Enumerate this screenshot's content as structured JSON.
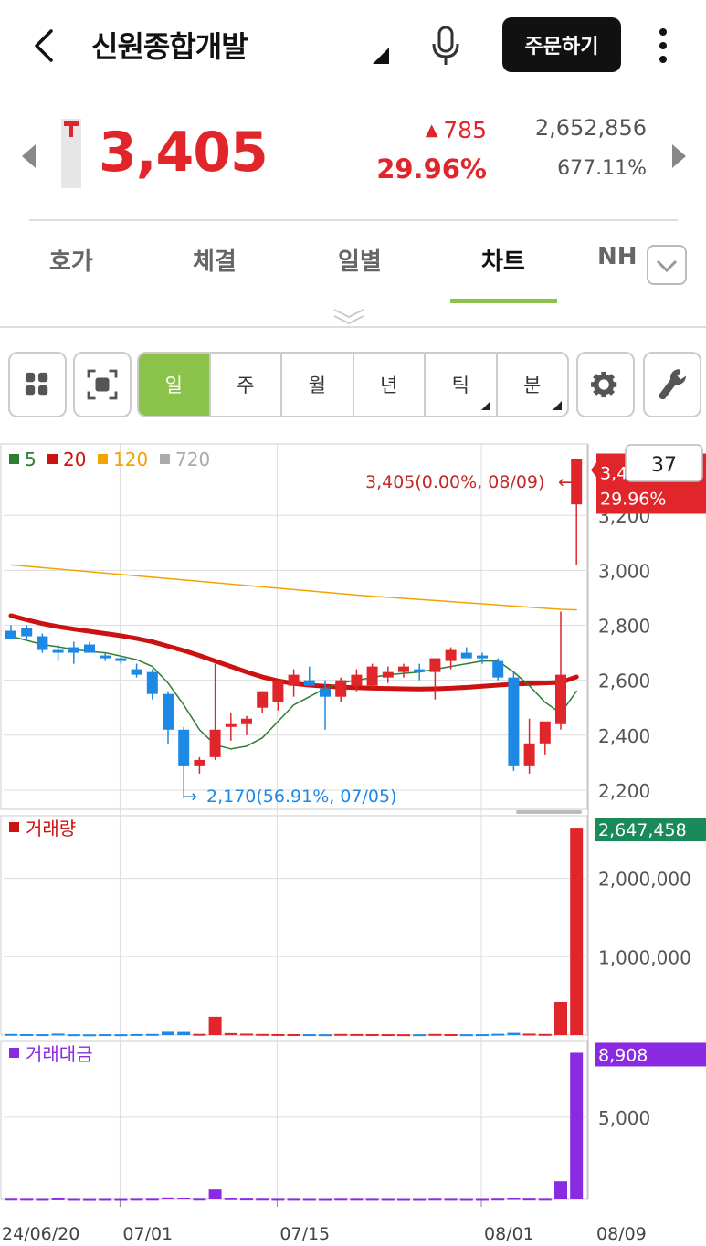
{
  "header": {
    "title": "신원종합개발",
    "order_label": "주문하기"
  },
  "quote": {
    "price": "3,405",
    "change": "785",
    "change_pct": "29.96%",
    "volume": "2,652,856",
    "volume_ratio": "677.11%"
  },
  "tabs": [
    {
      "label": "호가"
    },
    {
      "label": "체결"
    },
    {
      "label": "일별"
    },
    {
      "label": "차트"
    },
    {
      "label": "NH"
    }
  ],
  "period_buttons": [
    {
      "label": "일",
      "active": true
    },
    {
      "label": "주",
      "active": false
    },
    {
      "label": "월",
      "active": false
    },
    {
      "label": "년",
      "active": false
    },
    {
      "label": "틱",
      "active": false
    },
    {
      "label": "분",
      "active": false
    }
  ],
  "colors": {
    "up": "#e0262b",
    "down": "#1e88e5",
    "accent": "#8bc34a",
    "ma5": "#2e7d32",
    "ma20": "#cc1111",
    "ma120": "#f4a300",
    "ma720": "#aaaaaa",
    "value_bar": "#8a2be2",
    "vol_tag": "#1b8a5a"
  },
  "chart_data": [
    {
      "type": "candlestick",
      "legend": [
        {
          "name": "5",
          "color": "#2e7d32"
        },
        {
          "name": "20",
          "color": "#cc1111"
        },
        {
          "name": "120",
          "color": "#f4a300"
        },
        {
          "name": "720",
          "color": "#aaaaaa"
        }
      ],
      "y_ticks": [
        "3,200",
        "3,000",
        "2,800",
        "2,600",
        "2,400",
        "2,200"
      ],
      "ylim": [
        2130,
        3460
      ],
      "x_ticks": [
        "24/06/20",
        "07/01",
        "07/15",
        "08/01",
        "08/09"
      ],
      "candle_count_box": "37",
      "price_tag": {
        "value": "3,405",
        "pct": "29.96%"
      },
      "high_annotation": "3,405(0.00%, 08/09)",
      "low_annotation": "2,170(56.91%, 07/05)",
      "candles": [
        {
          "o": 2780,
          "h": 2800,
          "l": 2760,
          "c": 2750
        },
        {
          "o": 2790,
          "h": 2800,
          "l": 2750,
          "c": 2760
        },
        {
          "o": 2760,
          "h": 2770,
          "l": 2700,
          "c": 2710
        },
        {
          "o": 2710,
          "h": 2730,
          "l": 2670,
          "c": 2700
        },
        {
          "o": 2720,
          "h": 2740,
          "l": 2660,
          "c": 2700
        },
        {
          "o": 2730,
          "h": 2740,
          "l": 2700,
          "c": 2700
        },
        {
          "o": 2690,
          "h": 2700,
          "l": 2670,
          "c": 2680
        },
        {
          "o": 2680,
          "h": 2690,
          "l": 2660,
          "c": 2670
        },
        {
          "o": 2640,
          "h": 2660,
          "l": 2610,
          "c": 2620
        },
        {
          "o": 2630,
          "h": 2640,
          "l": 2530,
          "c": 2550
        },
        {
          "o": 2550,
          "h": 2560,
          "l": 2370,
          "c": 2420
        },
        {
          "o": 2420,
          "h": 2430,
          "l": 2170,
          "c": 2290
        },
        {
          "o": 2290,
          "h": 2320,
          "l": 2260,
          "c": 2310
        },
        {
          "o": 2320,
          "h": 2660,
          "l": 2310,
          "c": 2420
        },
        {
          "o": 2430,
          "h": 2480,
          "l": 2380,
          "c": 2440
        },
        {
          "o": 2440,
          "h": 2470,
          "l": 2400,
          "c": 2460
        },
        {
          "o": 2500,
          "h": 2560,
          "l": 2480,
          "c": 2560
        },
        {
          "o": 2520,
          "h": 2600,
          "l": 2490,
          "c": 2600
        },
        {
          "o": 2580,
          "h": 2640,
          "l": 2540,
          "c": 2620
        },
        {
          "o": 2600,
          "h": 2650,
          "l": 2580,
          "c": 2580
        },
        {
          "o": 2570,
          "h": 2600,
          "l": 2420,
          "c": 2540
        },
        {
          "o": 2540,
          "h": 2610,
          "l": 2520,
          "c": 2600
        },
        {
          "o": 2580,
          "h": 2640,
          "l": 2560,
          "c": 2620
        },
        {
          "o": 2580,
          "h": 2660,
          "l": 2570,
          "c": 2650
        },
        {
          "o": 2610,
          "h": 2650,
          "l": 2590,
          "c": 2630
        },
        {
          "o": 2630,
          "h": 2660,
          "l": 2610,
          "c": 2650
        },
        {
          "o": 2640,
          "h": 2660,
          "l": 2600,
          "c": 2630
        },
        {
          "o": 2630,
          "h": 2680,
          "l": 2530,
          "c": 2680
        },
        {
          "o": 2670,
          "h": 2720,
          "l": 2640,
          "c": 2710
        },
        {
          "o": 2700,
          "h": 2720,
          "l": 2680,
          "c": 2680
        },
        {
          "o": 2690,
          "h": 2700,
          "l": 2660,
          "c": 2680
        },
        {
          "o": 2670,
          "h": 2680,
          "l": 2600,
          "c": 2610
        },
        {
          "o": 2610,
          "h": 2630,
          "l": 2270,
          "c": 2290
        },
        {
          "o": 2290,
          "h": 2460,
          "l": 2260,
          "c": 2370
        },
        {
          "o": 2370,
          "h": 2430,
          "l": 2330,
          "c": 2450
        },
        {
          "o": 2440,
          "h": 2850,
          "l": 2420,
          "c": 2620
        },
        {
          "o": 3240,
          "h": 3405,
          "l": 3020,
          "c": 3405
        }
      ],
      "ma5": [
        2760,
        2745,
        2730,
        2722,
        2712,
        2705,
        2700,
        2688,
        2675,
        2650,
        2590,
        2510,
        2420,
        2365,
        2350,
        2360,
        2390,
        2450,
        2510,
        2540,
        2570,
        2590,
        2600,
        2610,
        2620,
        2625,
        2630,
        2640,
        2650,
        2660,
        2670,
        2670,
        2630,
        2580,
        2520,
        2480,
        2560
      ],
      "ma20": [
        2835,
        2820,
        2806,
        2795,
        2786,
        2778,
        2770,
        2762,
        2752,
        2740,
        2724,
        2708,
        2690,
        2670,
        2650,
        2630,
        2612,
        2598,
        2588,
        2582,
        2578,
        2575,
        2573,
        2571,
        2570,
        2569,
        2568,
        2569,
        2571,
        2574,
        2578,
        2582,
        2586,
        2588,
        2590,
        2592,
        2612
      ],
      "ma120": [
        3020,
        3015,
        3010,
        3005,
        3000,
        2995,
        2990,
        2985,
        2980,
        2975,
        2970,
        2965,
        2960,
        2955,
        2950,
        2945,
        2940,
        2935,
        2930,
        2925,
        2920,
        2915,
        2910,
        2906,
        2902,
        2898,
        2894,
        2890,
        2886,
        2882,
        2878,
        2874,
        2870,
        2866,
        2862,
        2858,
        2856
      ]
    },
    {
      "type": "bar",
      "name": "거래량",
      "y_ticks": [
        "2,000,000",
        "1,000,000"
      ],
      "ylim": [
        0,
        2800000
      ],
      "current_tag": "2,647,458",
      "values": [
        14000,
        12000,
        11000,
        18000,
        10000,
        9000,
        11000,
        10000,
        13000,
        14000,
        42000,
        40000,
        15000,
        235000,
        25000,
        18000,
        14000,
        12000,
        12000,
        11000,
        10000,
        14000,
        13000,
        12000,
        11000,
        10000,
        10000,
        14000,
        12000,
        10000,
        11000,
        16000,
        28000,
        18000,
        14000,
        420000,
        2647458
      ]
    },
    {
      "type": "bar",
      "name": "거래대금",
      "y_ticks": [
        "5,000"
      ],
      "ylim": [
        0,
        9600
      ],
      "current_tag": "8,908",
      "values": [
        40,
        35,
        30,
        60,
        30,
        25,
        30,
        28,
        36,
        38,
        120,
        110,
        40,
        600,
        70,
        48,
        40,
        34,
        34,
        30,
        28,
        38,
        36,
        34,
        30,
        28,
        28,
        40,
        34,
        28,
        30,
        42,
        80,
        45,
        36,
        1100,
        8908
      ]
    }
  ]
}
